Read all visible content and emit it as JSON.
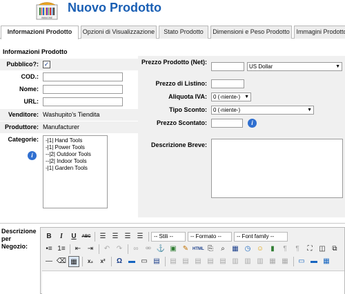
{
  "header": {
    "title": "Nuovo Prodotto",
    "logo_icon": "barcode-box-logo",
    "logo_text": "IMMAGINE"
  },
  "tabs": [
    {
      "label": "Informazioni Prodotto",
      "active": true
    },
    {
      "label": "Opzioni di Visualizzazione",
      "active": false
    },
    {
      "label": "Stato Prodotto",
      "active": false
    },
    {
      "label": "Dimensioni e Peso Prodotto",
      "active": false
    },
    {
      "label": "Immagini Prodotto",
      "active": false
    }
  ],
  "left": {
    "section_title": "Informazioni Prodotto",
    "pubblico_label": "Pubblico?:",
    "pubblico_checked": true,
    "cod_label": "COD.:",
    "cod_value": "",
    "nome_label": "Nome:",
    "nome_value": "",
    "url_label": "URL:",
    "url_value": "",
    "venditore_label": "Venditore:",
    "venditore_value": "Washupito's Tiendita",
    "produttore_label": "Produttore:",
    "produttore_value": "Manufacturer",
    "categorie_label": "Categorie:",
    "categories": [
      "-|1| Hand Tools",
      "-|1| Power Tools",
      "--|2| Outdoor Tools",
      "--|2| Indoor Tools",
      "-|1| Garden Tools"
    ]
  },
  "right": {
    "prezzo_label": "Prezzo Prodotto (Net):",
    "prezzo_value": "",
    "currency_selected": "US Dollar",
    "listino_label": "Prezzo di Listino:",
    "listino_value": "",
    "iva_label": "Aliquota IVA:",
    "iva_selected": "0 (-niente-)",
    "sconto_label": "Tipo Sconto:",
    "sconto_selected": "0 (-niente-)",
    "scontato_label": "Prezzo Scontato:",
    "scontato_value": "",
    "descrizione_breve_label": "Descrizione Breve:",
    "descrizione_breve_value": ""
  },
  "editor": {
    "label": "Descrizione per Negozio:",
    "styles_dropdown": "-- Stili --",
    "format_dropdown": "-- Formato --",
    "font_dropdown": "-- Font family --",
    "row1_buttons": [
      "B",
      "I",
      "U",
      "ABC"
    ],
    "html_button": "HTML"
  },
  "colors": {
    "title": "#1a5fb4",
    "info_icon": "#2f6fd0",
    "panel_bg": "#f0f0f0"
  }
}
